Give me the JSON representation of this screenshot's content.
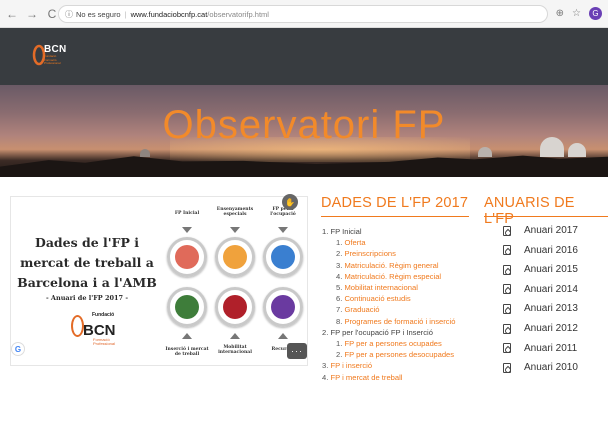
{
  "browser": {
    "back": "←",
    "forward": "→",
    "reload": "C",
    "security_icon": "ⓘ",
    "security_text": "No es seguro",
    "url_host": "www.fundaciobcnfp.cat",
    "url_path": "/observatorifp.html",
    "zoom_icon": "⊕",
    "star_icon": "☆",
    "profile_initial": "G"
  },
  "header": {
    "logo_text": "BCN",
    "logo_small": "Fundació Formació Professional"
  },
  "hero": {
    "title": "Observatori FP"
  },
  "card": {
    "title": "Dades de l'FP i mercat de treball a Barcelona i a l'AMB",
    "subtitle": "- Anuari de l'FP 2017 -",
    "logo_top": "Fundació",
    "logo_main": "BCN",
    "logo_bottom": "Formació Professional",
    "col_labels": [
      "FP Inicial",
      "Ensenyaments especials",
      "FP per a l'ocupació"
    ],
    "bottom_labels": [
      "Inserció i mercat de treball",
      "Mobilitat internacional",
      "Recursos"
    ],
    "more_label": "···",
    "google_label": "G",
    "hand_label": "✋",
    "colors": [
      "#e06a5a",
      "#f0a23c",
      "#3a7fd0",
      "#3e7d3a",
      "#b0202a",
      "#6a3aa0"
    ]
  },
  "dades": {
    "title": "DADES DE L'FP 2017",
    "items": [
      {
        "num": "1.",
        "label": "FP Inicial",
        "kind": "lvl1"
      },
      {
        "num": "1.",
        "label": "Oferta",
        "kind": "sub"
      },
      {
        "num": "2.",
        "label": "Preinscripcions",
        "kind": "sub"
      },
      {
        "num": "3.",
        "label": "Matriculació. Règim general",
        "kind": "sub"
      },
      {
        "num": "4.",
        "label": "Matriculació. Règim especial",
        "kind": "sub"
      },
      {
        "num": "5.",
        "label": "Mobilitat internacional",
        "kind": "sub"
      },
      {
        "num": "6.",
        "label": "Continuació estudis",
        "kind": "sub"
      },
      {
        "num": "7.",
        "label": "Graduació",
        "kind": "sub"
      },
      {
        "num": "8.",
        "label": "Programes de formació i inserció",
        "kind": "sub"
      },
      {
        "num": "2.",
        "label": "FP per l'ocupació   FP i Inserció",
        "kind": "lvl1"
      },
      {
        "num": "1.",
        "label": "FP per a persones ocupades",
        "kind": "sub"
      },
      {
        "num": "2.",
        "label": "FP per a persones desocupades",
        "kind": "sub"
      },
      {
        "num": "3.",
        "label": "FP i inserció",
        "kind": "top-orange"
      },
      {
        "num": "4.",
        "label": "FP i mercat de treball",
        "kind": "top-orange"
      }
    ]
  },
  "anuaris": {
    "title": "ANUARIS DE L'FP",
    "items": [
      "Anuari 2017",
      "Anuari 2016",
      "Anuari 2015",
      "Anuari 2014",
      "Anuari 2013",
      "Anuari 2012",
      "Anuari 2011",
      "Anuari 2010"
    ]
  },
  "theme": {
    "accent": "#f07a1e",
    "header_bg": "#383c40"
  }
}
